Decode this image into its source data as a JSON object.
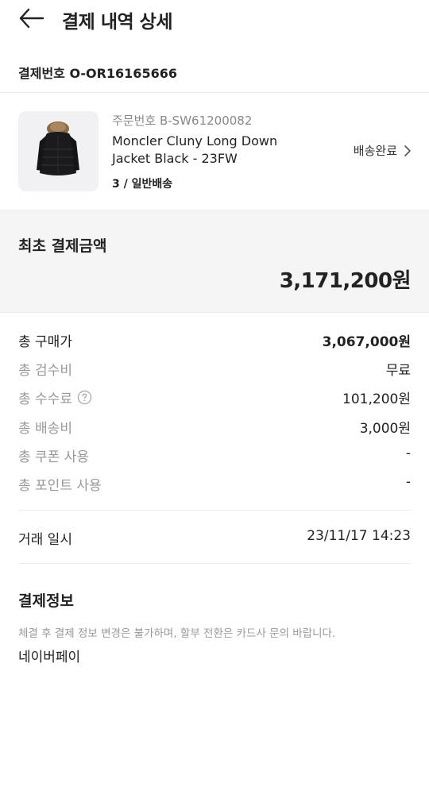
{
  "header": {
    "title": "결제 내역 상세",
    "back_icon": "arrow-left-icon"
  },
  "payment": {
    "number_label": "결제번호 O-OR16165666"
  },
  "order": {
    "order_no": "주문번호 B-SW61200082",
    "product_name_line1": "Moncler Cluny Long Down",
    "product_name_line2": "Jacket Black - 23FW",
    "qty_shipping": "3 / 일반배송",
    "status": "배송완료",
    "status_icon": "chevron-right-icon"
  },
  "summary": {
    "label": "최초 결제금액",
    "amount": "3,171,200원"
  },
  "lines": [
    {
      "label": "총 구매가",
      "value": "3,067,000원"
    },
    {
      "label": "총 검수비",
      "value": "무료"
    },
    {
      "label": "총 수수료",
      "value": "101,200원",
      "icon": "help-circle-icon"
    },
    {
      "label": "총 배송비",
      "value": "3,000원"
    },
    {
      "label": "총 쿠폰 사용",
      "value": "-"
    },
    {
      "label": "총 포인트 사용",
      "value": "-"
    }
  ],
  "trade": {
    "label": "거래 일시",
    "value": "23/11/17 14:23"
  },
  "payinfo": {
    "title": "결제정보",
    "note": "체결 후 결제 정보 변경은 불가하며, 할부 전환은 카드사 문의 바랍니다.",
    "method": "네이버페이"
  },
  "colors": {
    "text": "#222222",
    "muted": "#999999",
    "divider": "#ececec",
    "summary_bg": "#f5f5f5",
    "thumb_bg": "#f1f1f3"
  }
}
